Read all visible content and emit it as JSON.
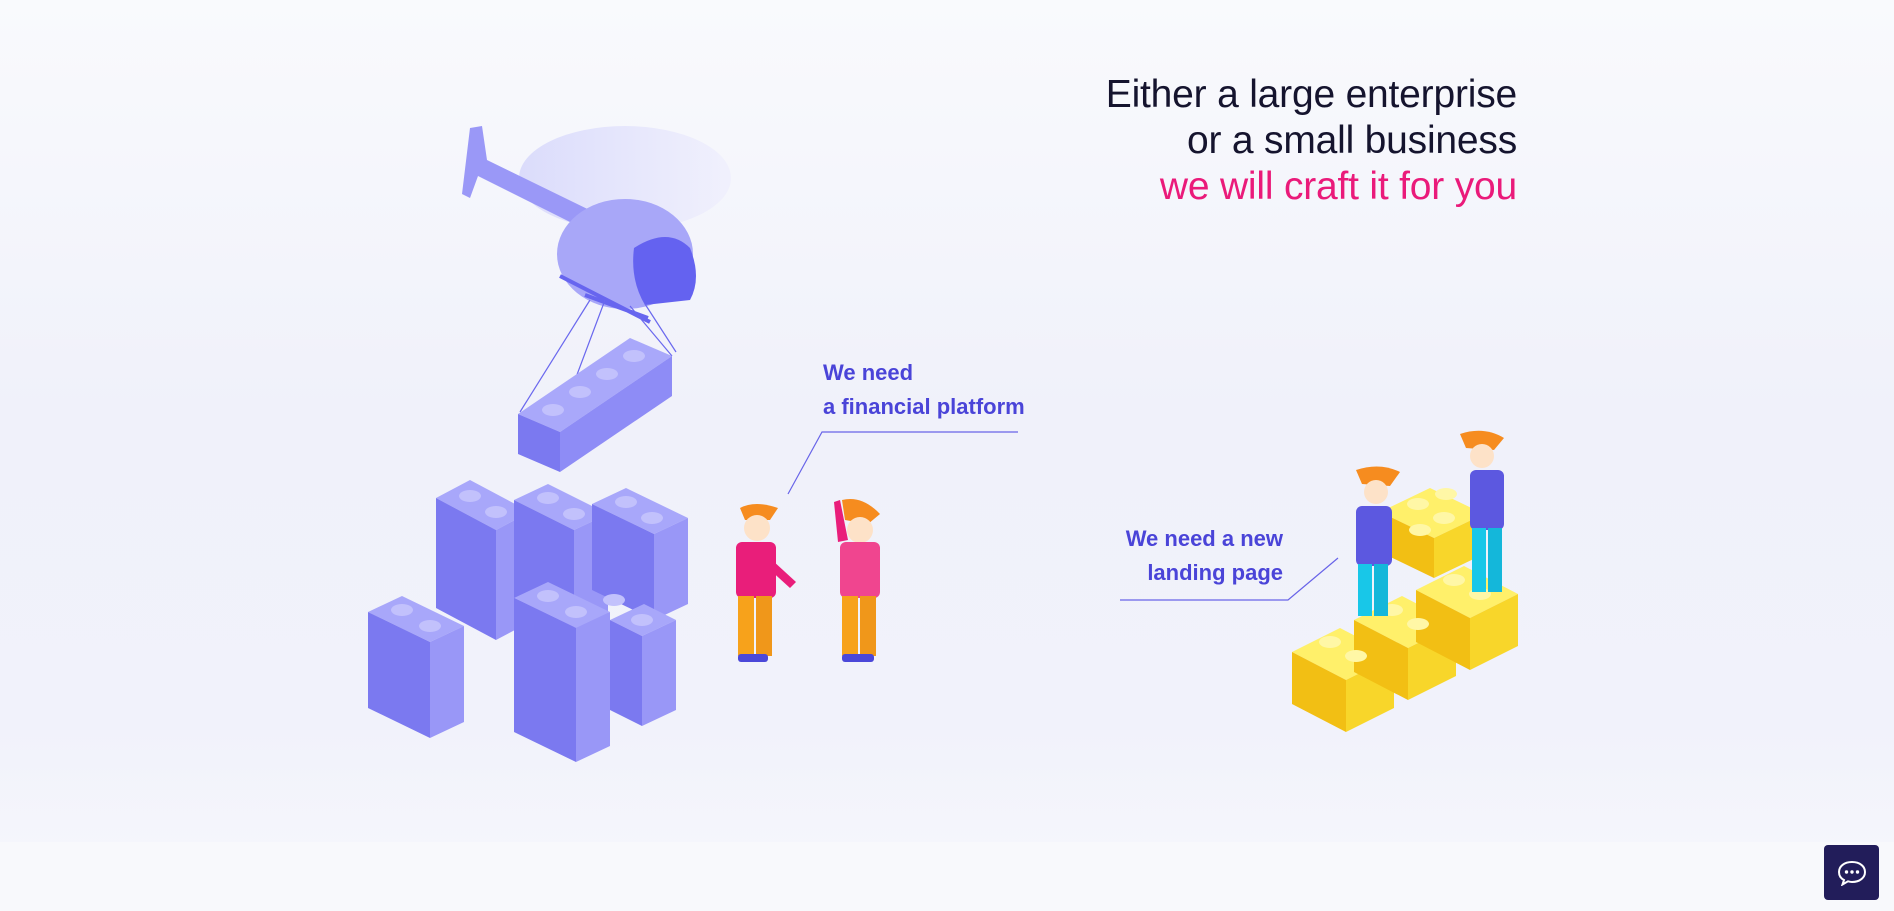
{
  "hero": {
    "headline_lines": [
      "Either a large enterprise",
      "or a small business"
    ],
    "headline_accent": "we will craft it for you"
  },
  "callouts": {
    "financial": [
      "We need",
      "a financial platform"
    ],
    "landing": [
      "We need a new",
      "landing page"
    ]
  },
  "colors": {
    "headline": "#15142e",
    "accent": "#ea1a7a",
    "callout": "#4a44d8",
    "brick_purple": "#8a88f5",
    "brick_yellow": "#f7d928",
    "chat_button": "#221d5a"
  },
  "icons": {
    "chat": "chat-bubble-icon"
  }
}
